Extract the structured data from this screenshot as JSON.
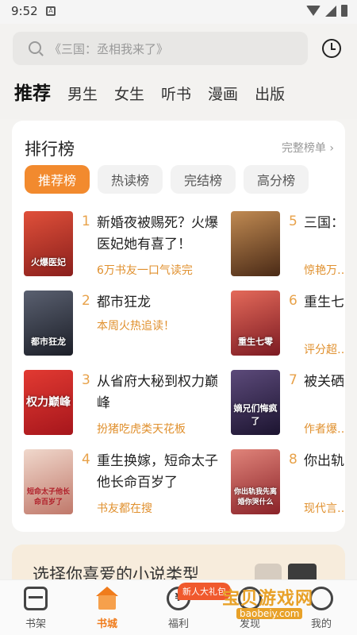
{
  "status_bar": {
    "time": "9:52",
    "app_badge": "A"
  },
  "search": {
    "placeholder": "《三国：丞相我来了》"
  },
  "tabs": [
    "推荐",
    "男生",
    "女生",
    "听书",
    "漫画",
    "出版"
  ],
  "ranking": {
    "title": "排行榜",
    "more": "完整榜单 ›",
    "chips": [
      "推荐榜",
      "热读榜",
      "完结榜",
      "高分榜"
    ],
    "books": [
      {
        "rank": "1",
        "title": "新婚夜被赐死？火爆医妃她有喜了！",
        "tag": "6万书友一口气读完",
        "cover_text": "火爆医妃",
        "cover_color": "#b8322a"
      },
      {
        "rank": "2",
        "title": "都市狂龙",
        "tag": "本周火热追读！",
        "cover_text": "都市狂龙",
        "cover_color": "#2a2f3c"
      },
      {
        "rank": "3",
        "title": "从省府大秘到权力巅峰",
        "tag": "扮猪吃虎类天花板",
        "cover_text": "权力巅峰",
        "cover_color": "#c9232a"
      },
      {
        "rank": "4",
        "title": "重生换嫁，短命太子他长命百岁了",
        "tag": "书友都在搜",
        "cover_text": "短命太子他长命百岁了",
        "cover_color": "#d9a79a"
      },
      {
        "rank": "5",
        "title": "三国：…走，我…",
        "tag": "惊艳万…",
        "cover_text": "",
        "cover_color": "#7a4a26"
      },
      {
        "rank": "6",
        "title": "重生七…猎养家…",
        "tag": "评分超…",
        "cover_text": "重生七零",
        "cover_color": "#a8323a"
      },
      {
        "rank": "7",
        "title": "被关硒…嫡兄们…",
        "tag": "作者爆…",
        "cover_text": "嫡兄们悔疯了",
        "cover_color": "#3c2a55"
      },
      {
        "rank": "8",
        "title": "你出轨…婚你哭…",
        "tag": "现代言…",
        "cover_text": "你出轨我先离婚你哭什么",
        "cover_color": "#b53a3c"
      }
    ]
  },
  "category_card": {
    "text": "选择你喜爱的小说类型"
  },
  "promo_badge": "新人大礼包",
  "bottom_nav": {
    "items": [
      {
        "label": "书架",
        "icon": "bookshelf-icon"
      },
      {
        "label": "书城",
        "icon": "bookstore-home-icon",
        "active": true
      },
      {
        "label": "福利",
        "icon": "coin-icon"
      },
      {
        "label": "发现",
        "icon": "discover-icon"
      },
      {
        "label": "我的",
        "icon": "profile-icon"
      }
    ]
  },
  "watermark": {
    "name": "宝贝游戏网",
    "url": "baobeiy.com"
  },
  "colors": {
    "accent": "#f28a2e",
    "tag": "#e0902e",
    "rank": "#e8a24a"
  }
}
